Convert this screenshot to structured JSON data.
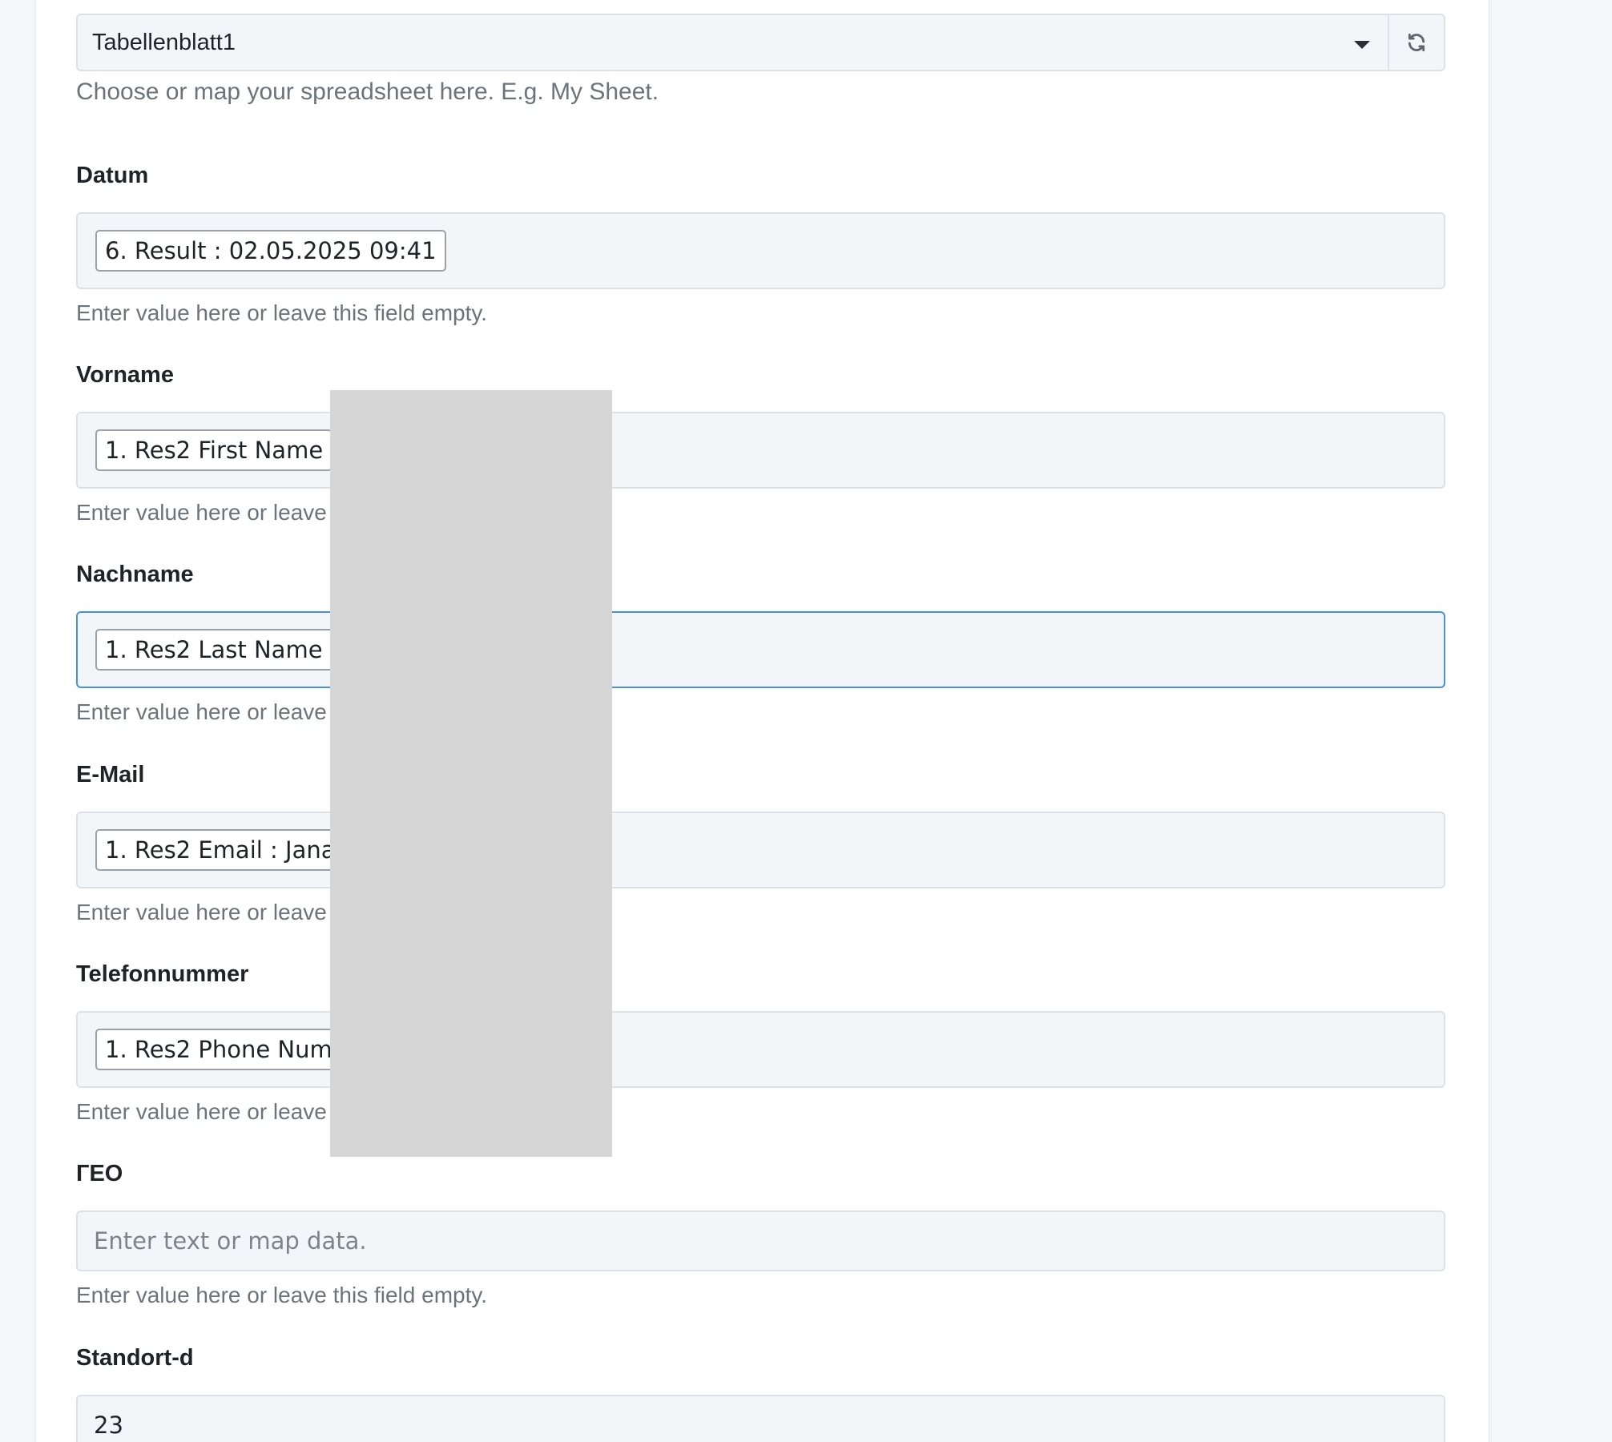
{
  "spreadsheet": {
    "selected": "Tabellenblatt1",
    "help": "Choose or map your spreadsheet here. E.g. My Sheet."
  },
  "fields": [
    {
      "label": "Datum",
      "pill": "6. Result : 02.05.2025 09:41",
      "help": "Enter value here or leave this field empty."
    },
    {
      "label": "Vorname",
      "pill": "1. Res2 First Name",
      "help": "Enter value here or leave"
    },
    {
      "label": "Nachname",
      "pill": "1. Res2 Last Name :",
      "help": "Enter value here or leave"
    },
    {
      "label": "E-Mail",
      "pill": "1. Res2 Email : Jana",
      "help": "Enter value here or leave"
    },
    {
      "label": "Telefonnummer",
      "pill": "1. Res2 Phone Numb",
      "help": "Enter value here or leave"
    },
    {
      "label": "ГЕО",
      "placeholder": "Enter text or map data.",
      "help": "Enter value here or leave this field empty."
    },
    {
      "label": "Standort-d",
      "value": "23"
    }
  ]
}
